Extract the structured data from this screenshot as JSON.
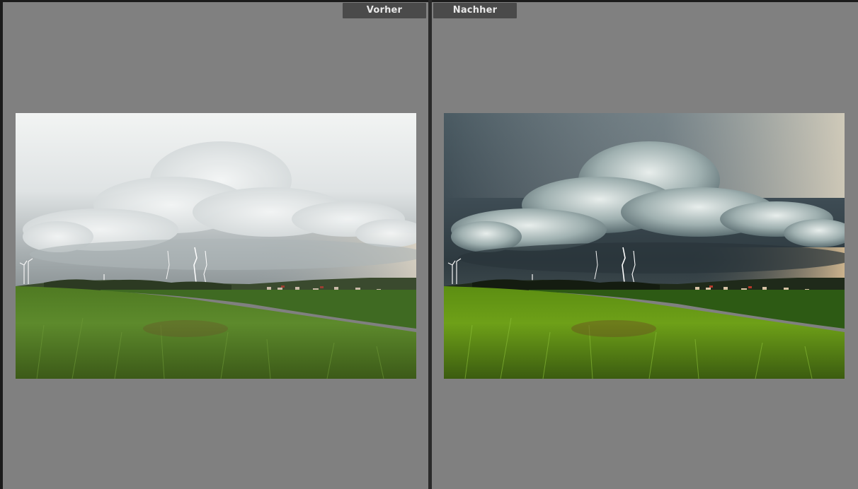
{
  "view": {
    "before_label": "Vorher",
    "after_label": "Nachher"
  },
  "colors": {
    "background": "#808080",
    "divider": "#2a2a2a",
    "tab_bg": "#4a4a4a",
    "tab_text": "#e8e8e8"
  }
}
